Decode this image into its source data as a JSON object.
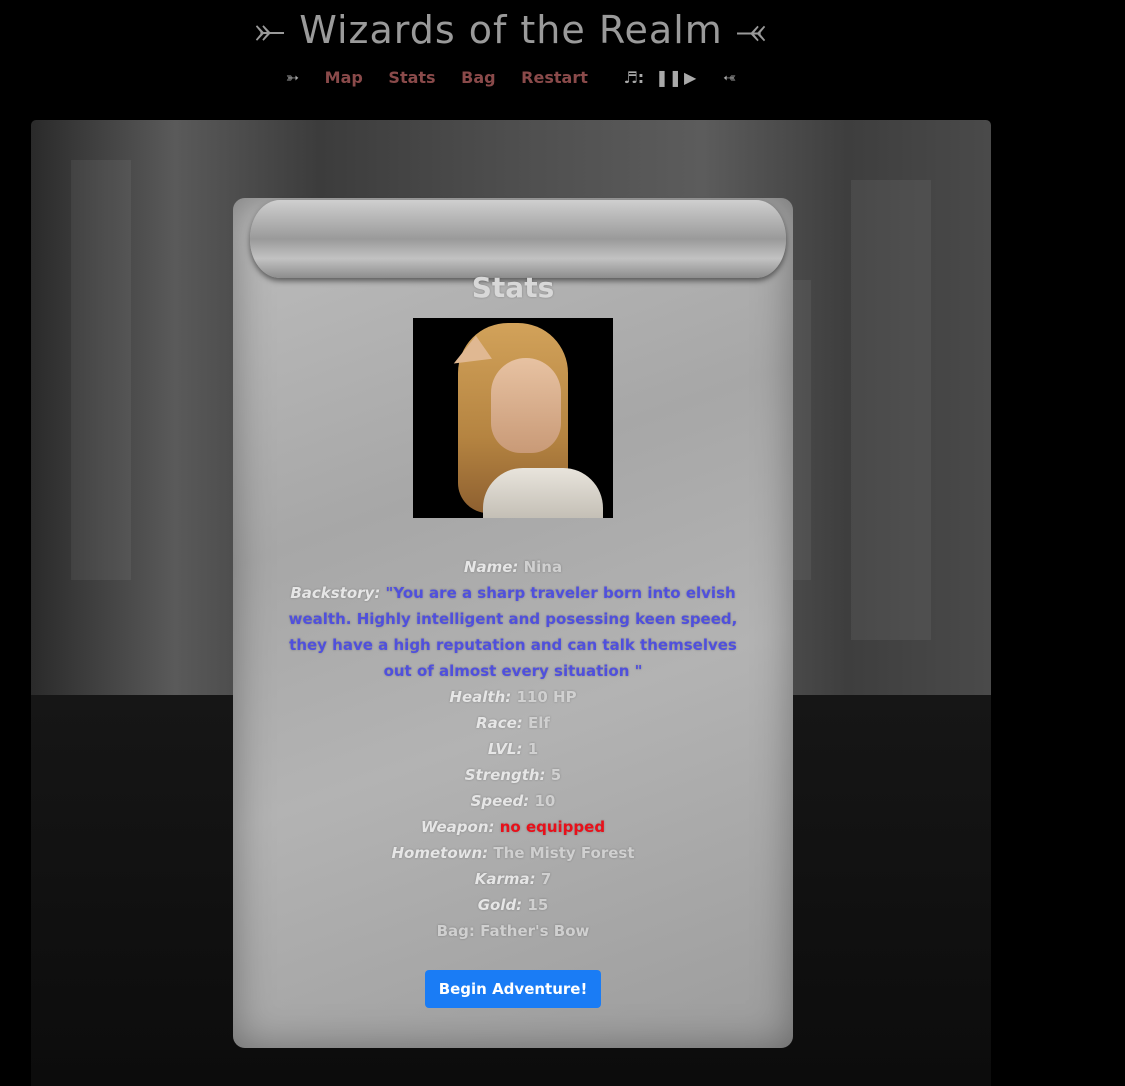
{
  "header": {
    "title": "⤜ Wizards of the Realm ⤛",
    "nav": {
      "left_deco": "➳",
      "map": "Map",
      "stats": "Stats",
      "bag": "Bag",
      "restart": "Restart",
      "music_label": "♬:",
      "pause": "❚❚",
      "play": "▶",
      "right_deco": "➳"
    }
  },
  "stats_panel": {
    "title": "Stats",
    "portrait_alt": "Elf character portrait",
    "rows": {
      "name": {
        "label": "Name:",
        "value": "Nina"
      },
      "backstory": {
        "label": "Backstory:",
        "value": "\"You are a sharp traveler born into elvish wealth. Highly intelligent and posessing keen speed, they have a high reputation and can talk themselves out of almost every situation \""
      },
      "health": {
        "label": "Health:",
        "value": "110 HP"
      },
      "race": {
        "label": "Race:",
        "value": "Elf"
      },
      "lvl": {
        "label": "LVL:",
        "value": "1"
      },
      "strength": {
        "label": "Strength:",
        "value": "5"
      },
      "speed": {
        "label": "Speed:",
        "value": "10"
      },
      "weapon": {
        "label": "Weapon:",
        "value": "no equipped"
      },
      "hometown": {
        "label": "Hometown:",
        "value": "The Misty Forest"
      },
      "karma": {
        "label": "Karma:",
        "value": "7"
      },
      "gold": {
        "label": "Gold:",
        "value": "15"
      },
      "bag": {
        "text": "Bag: Father's Bow"
      }
    },
    "button": "Begin Adventure!"
  },
  "colors": {
    "background": "#000000",
    "nav_link": "#8a4a4a",
    "backstory": "#5050dd",
    "warning": "#e8101a",
    "button": "#1a7cf5"
  }
}
